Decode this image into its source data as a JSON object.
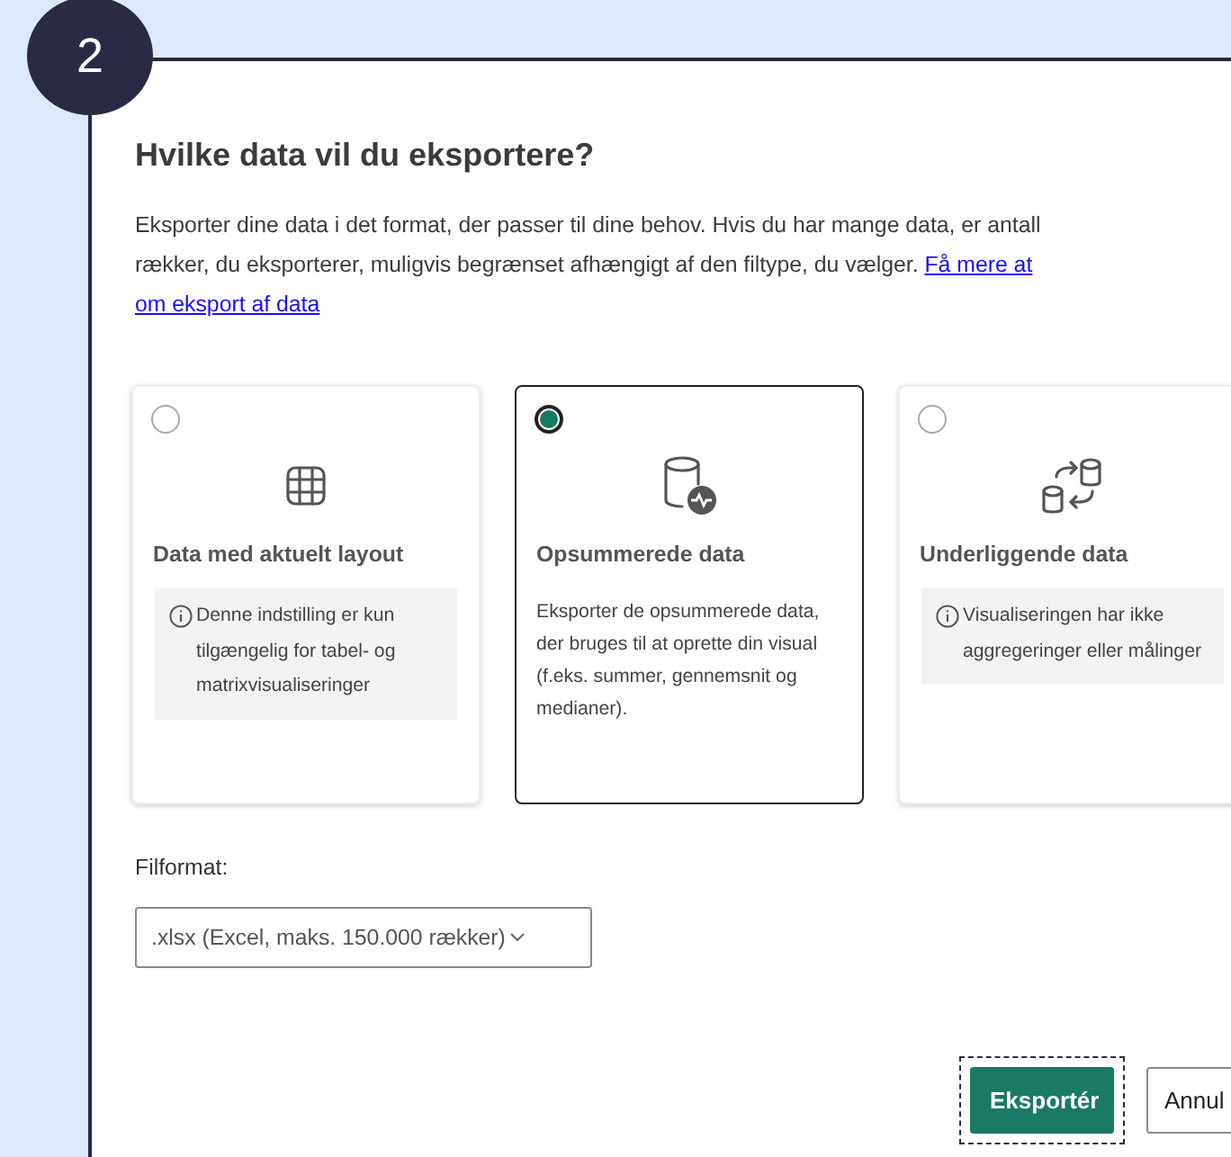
{
  "step_badge": "2",
  "dialog": {
    "title": "Hvilke data vil du eksportere?",
    "description_lines": [
      "Eksporter dine data i det format, der passer til dine behov. Hvis du har mange data, er antall",
      "rækker, du eksporterer, muligvis begrænset afhængigt af den filtype, du vælger."
    ],
    "link_lines": [
      "Få mere at",
      "om eksport af data"
    ],
    "options": [
      {
        "kind": "table",
        "title": "Data med aktuelt layout",
        "note": {
          "kind": "info",
          "text": "Denne indstilling er kun tilgængelig for tabel- og matrixvisualiseringer"
        },
        "selected": false
      },
      {
        "kind": "summary",
        "title": "Opsummerede data",
        "note": {
          "kind": "plain",
          "text": "Eksporter de opsummerede data, der bruges til at oprette din visual (f.eks. summer, gennemsnit og medianer)."
        },
        "selected": true
      },
      {
        "kind": "underlying",
        "title": "Underliggende data",
        "note": {
          "kind": "info",
          "text": "Visualiseringen har ikke aggregeringer eller målinger"
        },
        "selected": false
      }
    ],
    "format": {
      "label": "Filformat:",
      "value": ".xlsx (Excel, maks. 150.000 rækker)"
    },
    "buttons": [
      {
        "kind": "primary",
        "label": "Eksportér",
        "focused": true
      },
      {
        "kind": "secondary",
        "label": "Annul",
        "focused": false
      }
    ]
  }
}
